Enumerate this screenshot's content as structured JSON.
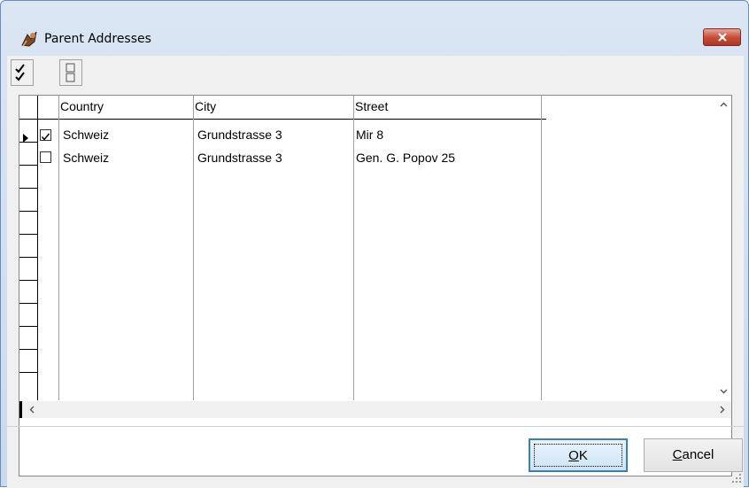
{
  "window": {
    "title": "Parent Addresses",
    "close_label": "x"
  },
  "toolbar": {
    "icons": [
      "check-all-icon",
      "uncheck-all-icon"
    ]
  },
  "table": {
    "columns": [
      "Country",
      "City",
      "Street"
    ],
    "rows": [
      {
        "checked": true,
        "current": true,
        "country": "Schweiz",
        "city": "Grundstrasse 3",
        "street": "Mir 8"
      },
      {
        "checked": false,
        "current": false,
        "country": "Schweiz",
        "city": "Grundstrasse 3",
        "street": "Gen. G. Popov 25"
      }
    ]
  },
  "buttons": {
    "ok_label_access_key": "O",
    "ok_label_rest": "K",
    "cancel_label_access_key": "C",
    "cancel_label_rest": "ancel"
  },
  "colors": {
    "title_bar": "#dbe6f4",
    "close_button": "#c7503a",
    "default_button_border": "#3c7fb1"
  }
}
